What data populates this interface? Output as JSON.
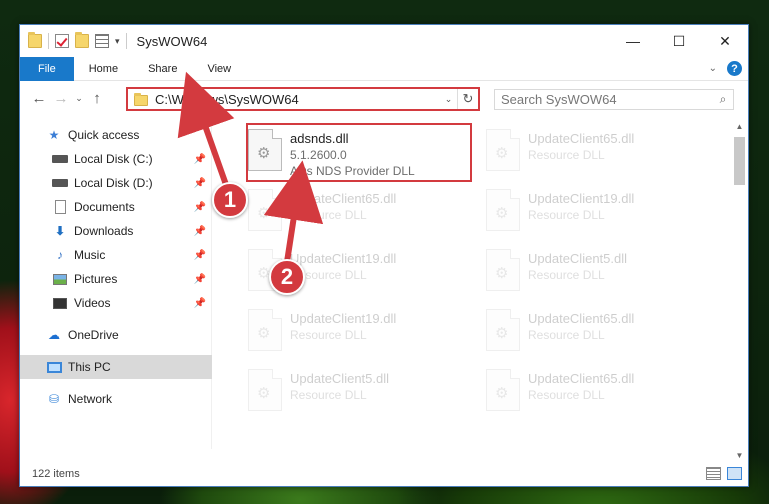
{
  "window": {
    "title": "SysWOW64",
    "controls": {
      "minimize": "—",
      "maximize": "☐",
      "close": "✕"
    }
  },
  "ribbon": {
    "tabs": [
      "File",
      "Home",
      "Share",
      "View"
    ],
    "collapse_glyph": "⌄",
    "help_glyph": "?"
  },
  "nav": {
    "back": "←",
    "forward": "→",
    "recent": "⌄",
    "up": "↑",
    "address": "C:\\Windows\\SysWOW64",
    "address_dropdown": "⌄",
    "refresh": "↻",
    "search_placeholder": "Search SysWOW64",
    "search_glyph": "⌕"
  },
  "sidebar": {
    "items": [
      {
        "label": "Quick access",
        "icon": "star-icon",
        "glyph": "★"
      },
      {
        "label": "Local Disk (C:)",
        "icon": "drive-icon",
        "pinned": true
      },
      {
        "label": "Local Disk (D:)",
        "icon": "drive-icon",
        "pinned": true
      },
      {
        "label": "Documents",
        "icon": "document-icon",
        "pinned": true
      },
      {
        "label": "Downloads",
        "icon": "download-icon",
        "glyph": "⬇",
        "pinned": true
      },
      {
        "label": "Music",
        "icon": "music-icon",
        "glyph": "♪",
        "pinned": true
      },
      {
        "label": "Pictures",
        "icon": "pictures-icon",
        "pinned": true
      },
      {
        "label": "Videos",
        "icon": "videos-icon",
        "pinned": true
      },
      {
        "label": "OneDrive",
        "icon": "cloud-icon",
        "glyph": "☁"
      },
      {
        "label": "This PC",
        "icon": "computer-icon",
        "selected": true
      },
      {
        "label": "Network",
        "icon": "network-icon",
        "glyph": "⛁"
      }
    ],
    "pin_glyph": "📌"
  },
  "files": [
    {
      "name": "adsnds.dll",
      "version": "5.1.2600.0",
      "description": "ADs NDS Provider DLL",
      "highlighted": true
    },
    {
      "name": "UpdateClient65.dll",
      "description": "Resource DLL"
    },
    {
      "name": "UpdateClient65.dll",
      "description": "Resource DLL"
    },
    {
      "name": "UpdateClient19.dll",
      "description": "Resource DLL"
    },
    {
      "name": "UpdateClient19.dll",
      "description": "Resource DLL"
    },
    {
      "name": "UpdateClient5.dll",
      "description": "Resource DLL"
    },
    {
      "name": "UpdateClient19.dll",
      "description": "Resource DLL"
    },
    {
      "name": "UpdateClient65.dll",
      "description": "Resource DLL"
    },
    {
      "name": "UpdateClient5.dll",
      "description": "Resource DLL"
    },
    {
      "name": "UpdateClient65.dll",
      "description": "Resource DLL"
    }
  ],
  "callouts": [
    "1",
    "2"
  ],
  "status": {
    "item_count": "122 items"
  },
  "colors": {
    "accent": "#1979ca",
    "highlight": "#d33a3f"
  }
}
